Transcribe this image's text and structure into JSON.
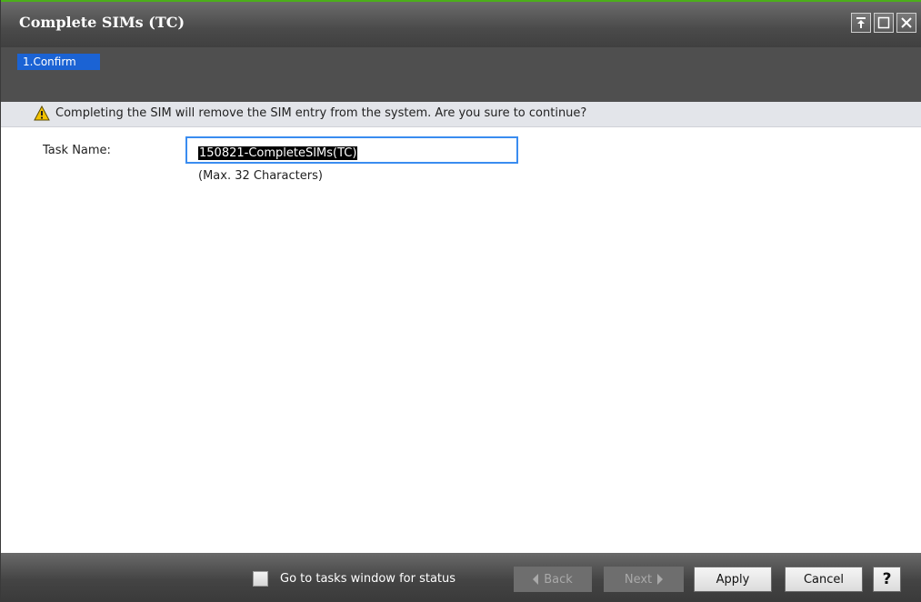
{
  "window": {
    "title": "Complete SIMs (TC)"
  },
  "steps": [
    {
      "label": "1.Confirm",
      "active": true
    }
  ],
  "warning": {
    "icon": "warning-triangle-icon",
    "text": "Completing the SIM will remove the SIM entry from the system. Are you sure to continue?"
  },
  "form": {
    "task_name_label": "Task Name:",
    "task_name_value": "150821-CompleteSIMs(TC)",
    "task_name_hint": "(Max. 32 Characters)"
  },
  "footer": {
    "checkbox_label": "Go to tasks window for status",
    "checkbox_checked": false,
    "back_label": "Back",
    "next_label": "Next",
    "apply_label": "Apply",
    "cancel_label": "Cancel",
    "help_label": "?"
  },
  "colors": {
    "accent": "#1b63d4",
    "input_border": "#3a8cf0",
    "title_bar": "#4a4a4a",
    "warning": "#f2c200"
  }
}
